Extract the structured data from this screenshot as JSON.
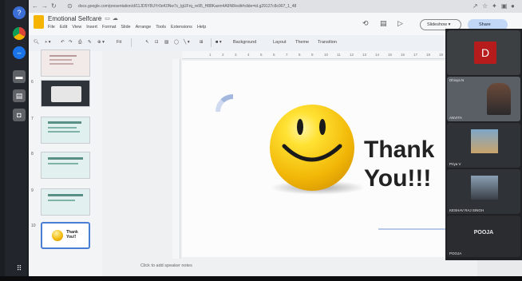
{
  "browser": {
    "url": "docs.google.com/presentation/d/11JD5Y8UYr0eK0Nw7c_lgUFrq_re95_H88Kaxm4A9N8/edit#slide=id.g29127c8c907_1_48"
  },
  "app": {
    "title": "Emotional Selfcare",
    "menu": [
      "File",
      "Edit",
      "View",
      "Insert",
      "Format",
      "Slide",
      "Arrange",
      "Tools",
      "Extensions",
      "Help"
    ],
    "slideshow_label": "Slideshow",
    "share_label": "Share"
  },
  "toolbar": {
    "zoom": "Fit",
    "background": "Background",
    "layout": "Layout",
    "theme": "Theme",
    "transition": "Transition"
  },
  "ruler": {
    "marks": [
      "1",
      "2",
      "3",
      "4",
      "5",
      "6",
      "7",
      "8",
      "9",
      "10",
      "11",
      "12",
      "13",
      "14",
      "15",
      "16",
      "17",
      "18",
      "19",
      "20",
      "21",
      "22"
    ]
  },
  "filmstrip": {
    "slides": [
      {
        "num": "",
        "thumb_text": ""
      },
      {
        "num": "6",
        "thumb_text": ""
      },
      {
        "num": "7",
        "thumb_text": ""
      },
      {
        "num": "8",
        "thumb_text": ""
      },
      {
        "num": "9",
        "thumb_text": ""
      },
      {
        "num": "10",
        "thumb_text": "Thank You!!"
      }
    ]
  },
  "slide": {
    "line1": "Thank",
    "line2": "You!!!"
  },
  "notes_placeholder": "Click to add speaker notes",
  "meet": {
    "tiles": [
      {
        "name": "",
        "initial": "D",
        "color": "#b71c1c"
      },
      {
        "name": "Dhivya N",
        "initial": ""
      },
      {
        "name": "ANVITA",
        "initial": ""
      },
      {
        "name": "Priya V",
        "initial": ""
      },
      {
        "name": "KESHAV RAJ SINGH",
        "initial": ""
      },
      {
        "name": "POOJA",
        "initial": ""
      }
    ],
    "self_label": "POOJA"
  },
  "colors": {
    "accent_blue": "#4a7dd4",
    "docs_yellow": "#f4b400",
    "avatar_red": "#b71c1c",
    "share_bg": "#c2d7f5"
  }
}
